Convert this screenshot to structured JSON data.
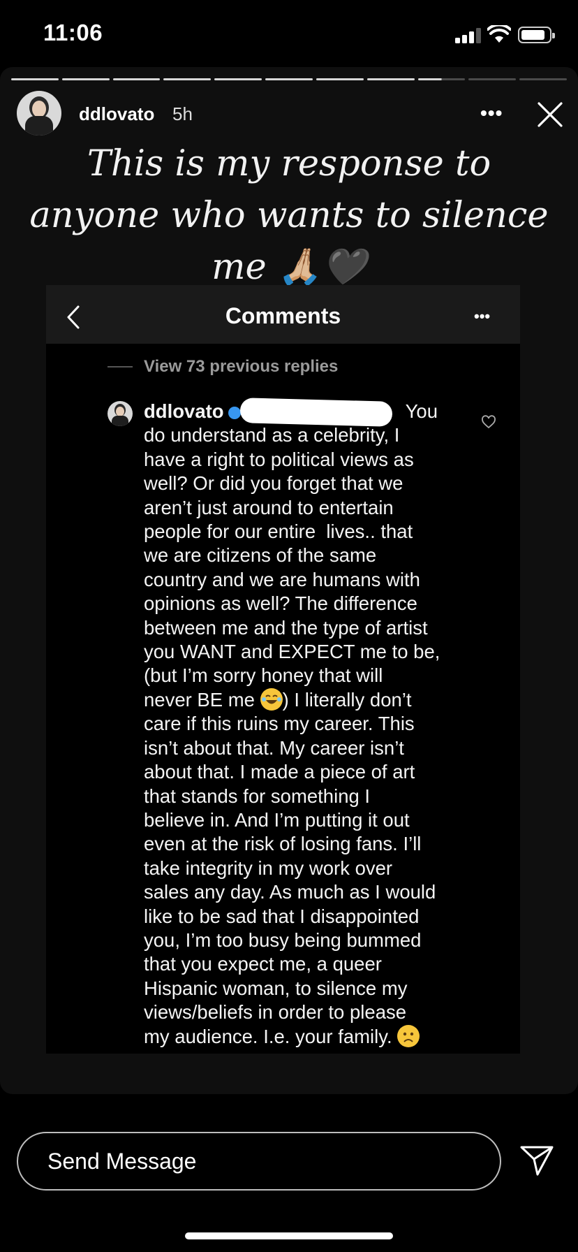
{
  "status_bar": {
    "time": "11:06"
  },
  "story": {
    "username": "ddlovato",
    "posted_ago": "5h",
    "more_label": "•••",
    "progress": {
      "segments": 11,
      "active_index": 8,
      "active_fraction": 0.5
    },
    "caption_lines": [
      "This is my response to",
      "anyone who wants to silence",
      "me 🙏🏼🖤"
    ]
  },
  "embedded_comments": {
    "title": "Comments",
    "more_label": "•••",
    "view_previous": "View 73 previous replies",
    "comment": {
      "username": "ddlovato",
      "lines": [
        "You",
        "do understand as a celebrity, I",
        "have a right to political views as",
        "well? Or did you forget that we",
        "aren’t just around to entertain",
        "people for our entire  lives.. that",
        "we are citizens of the same",
        "country and we are humans with",
        "opinions as well? The difference",
        "between me and the type of artist",
        "you WANT and EXPECT me to be,",
        "(but I’m sorry honey that will",
        "never BE me",
        ") I literally don’t",
        "care if this ruins my career. This",
        "isn’t about that. My career isn’t",
        "about that. I made a piece of art",
        "that stands for something I",
        "believe in. And I’m putting it out",
        "even at the risk of losing fans. I’ll",
        "take integrity in my work over",
        "sales any day. As much as I would",
        "like to be sad that I disappointed",
        "you, I’m too busy being bummed",
        "that you expect me, a queer",
        "Hispanic woman, to silence my",
        "views/beliefs in order to please",
        "my audience. I.e. your family."
      ]
    }
  },
  "reply": {
    "placeholder": "Send Message"
  },
  "icons": [
    "cellular-signal-icon",
    "wifi-icon",
    "battery-icon",
    "close-icon",
    "back-chevron-icon",
    "heart-icon",
    "send-icon",
    "verified-badge-icon",
    "laughing-emoji-icon",
    "frowning-emoji-icon"
  ]
}
